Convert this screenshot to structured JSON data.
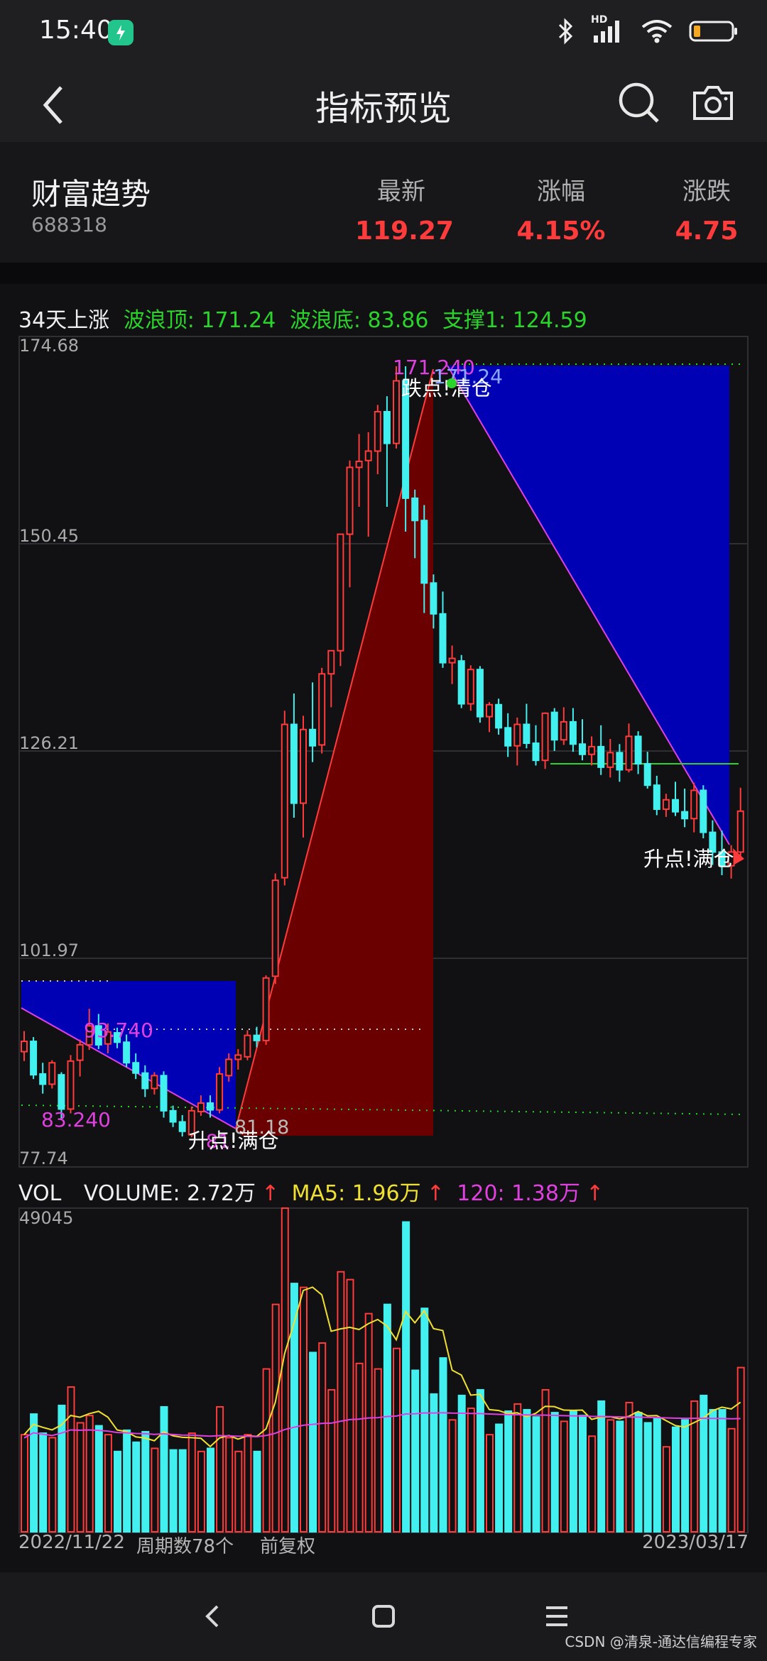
{
  "status_bar": {
    "time": "15:40",
    "network": "HD"
  },
  "nav": {
    "title": "指标预览",
    "icons": [
      "back-icon",
      "search-icon",
      "camera-icon"
    ]
  },
  "quote": {
    "name": "财富趋势",
    "code": "688318",
    "latest_label": "最新",
    "latest": "119.27",
    "change_pct_label": "涨幅",
    "change_pct": "4.15%",
    "change_label": "涨跌",
    "change": "4.75"
  },
  "indicator": {
    "label": "34天上涨",
    "wave_top": "波浪顶: 171.24",
    "wave_bottom": "波浪底: 83.86",
    "support": "支撑1: 124.59"
  },
  "price_axis": [
    "174.68",
    "150.45",
    "126.21",
    "101.97",
    "77.74"
  ],
  "annotations": {
    "top_value": "171.240",
    "top_value2": "171.24",
    "sell_text": "跌点!清仓",
    "low1": "93.740",
    "low2": "83.240",
    "low3_value": "81.18",
    "low3_prefix": "81.",
    "buy_text1": "升点!满仓",
    "buy_text2": "升点!满仓"
  },
  "volume": {
    "label": "VOL",
    "volume": "VOLUME: 2.72万",
    "ma5": "MA5: 1.96万",
    "ma120": "120: 1.38万",
    "axis_max": "49045"
  },
  "footer": {
    "start_date": "2022/11/22",
    "period_count": "周期数78个",
    "adjust": "前复权",
    "end_date": "2023/03/17"
  },
  "watermark": "CSDN @清泉-通达信编程专家",
  "colors": {
    "up": "#ff3b3b",
    "down": "#43f0f0",
    "indicator_green": "#2bd42b",
    "magenta": "#e040e0",
    "ma5": "#f0e030",
    "blue_zone": "#0000b4",
    "red_zone": "#6b0000"
  },
  "chart_data": {
    "type": "candlestick",
    "ylim": [
      77.74,
      174.68
    ],
    "candles": [
      [
        91.2,
        93.6,
        90.1,
        92.4
      ],
      [
        92.4,
        92.9,
        88.0,
        88.5
      ],
      [
        88.6,
        89.9,
        86.3,
        87.4
      ],
      [
        87.4,
        90.2,
        86.9,
        89.9
      ],
      [
        88.5,
        88.8,
        83.3,
        84.5
      ],
      [
        84.5,
        90.8,
        84.0,
        90.1
      ],
      [
        90.2,
        92.6,
        88.3,
        92.0
      ],
      [
        92.0,
        96.2,
        91.4,
        94.2
      ],
      [
        94.2,
        95.6,
        91.5,
        92.0
      ],
      [
        92.1,
        94.5,
        91.0,
        93.5
      ],
      [
        93.4,
        94.0,
        91.6,
        92.3
      ],
      [
        92.3,
        93.2,
        89.4,
        89.9
      ],
      [
        89.9,
        91.0,
        88.0,
        88.7
      ],
      [
        88.7,
        89.6,
        85.9,
        86.9
      ],
      [
        86.9,
        88.8,
        86.2,
        88.4
      ],
      [
        88.4,
        88.9,
        83.5,
        84.3
      ],
      [
        84.3,
        84.9,
        82.4,
        83.0
      ],
      [
        83.0,
        83.8,
        81.3,
        81.9
      ],
      [
        81.5,
        84.8,
        81.2,
        84.3
      ],
      [
        84.2,
        86.1,
        83.7,
        85.2
      ],
      [
        85.2,
        86.1,
        83.5,
        84.4
      ],
      [
        84.4,
        89.4,
        84.0,
        88.6
      ],
      [
        88.4,
        91.0,
        87.7,
        90.3
      ],
      [
        90.3,
        91.5,
        89.1,
        90.8
      ],
      [
        90.6,
        93.7,
        90.2,
        93.1
      ],
      [
        93.1,
        94.1,
        91.7,
        92.5
      ],
      [
        92.5,
        100.1,
        92.0,
        99.8
      ],
      [
        100.0,
        112.0,
        99.1,
        111.2
      ],
      [
        111.5,
        131.0,
        110.6,
        129.4
      ],
      [
        129.4,
        133.0,
        118.5,
        120.2
      ],
      [
        120.2,
        130.4,
        116.2,
        128.8
      ],
      [
        128.8,
        134.3,
        125.0,
        126.9
      ],
      [
        127.0,
        136.0,
        126.0,
        135.3
      ],
      [
        135.3,
        138.0,
        131.4,
        138.0
      ],
      [
        138.0,
        151.6,
        136.2,
        151.6
      ],
      [
        151.6,
        160.2,
        145.4,
        159.4
      ],
      [
        159.4,
        163.3,
        154.8,
        160.1
      ],
      [
        160.2,
        163.5,
        151.3,
        161.3
      ],
      [
        161.3,
        166.7,
        158.6,
        165.9
      ],
      [
        165.9,
        167.7,
        154.8,
        162.2
      ],
      [
        162.2,
        171.2,
        161.6,
        169.5
      ],
      [
        169.5,
        171.2,
        151.9,
        155.8
      ],
      [
        155.8,
        156.8,
        148.8,
        153.2
      ],
      [
        153.2,
        155.0,
        142.4,
        145.9
      ],
      [
        145.9,
        146.9,
        140.6,
        142.3
      ],
      [
        142.3,
        144.9,
        136.0,
        136.6
      ],
      [
        136.6,
        138.6,
        134.1,
        137.1
      ],
      [
        136.8,
        137.5,
        131.3,
        131.8
      ],
      [
        131.8,
        136.3,
        131.0,
        135.8
      ],
      [
        135.8,
        136.2,
        129.6,
        130.3
      ],
      [
        130.3,
        132.0,
        128.5,
        131.7
      ],
      [
        131.7,
        132.4,
        128.2,
        129.0
      ],
      [
        129.0,
        130.7,
        125.6,
        126.9
      ],
      [
        126.9,
        130.2,
        124.6,
        129.4
      ],
      [
        129.4,
        131.8,
        126.6,
        127.2
      ],
      [
        127.2,
        129.3,
        124.6,
        125.2
      ],
      [
        125.2,
        130.8,
        124.2,
        130.7
      ],
      [
        130.8,
        131.3,
        126.3,
        127.6
      ],
      [
        127.6,
        131.4,
        127.0,
        129.7
      ],
      [
        129.7,
        131.3,
        126.2,
        127.1
      ],
      [
        127.1,
        130.0,
        125.2,
        125.9
      ],
      [
        125.9,
        128.0,
        124.6,
        126.8
      ],
      [
        126.8,
        129.3,
        123.5,
        124.4
      ],
      [
        124.4,
        127.7,
        123.2,
        126.1
      ],
      [
        126.1,
        127.1,
        122.7,
        124.1
      ],
      [
        124.1,
        129.5,
        123.8,
        128.0
      ],
      [
        128.0,
        128.6,
        123.6,
        124.8
      ],
      [
        124.8,
        126.2,
        121.9,
        122.3
      ],
      [
        122.3,
        123.4,
        118.8,
        119.5
      ],
      [
        119.5,
        121.3,
        118.6,
        120.6
      ],
      [
        120.6,
        122.7,
        118.7,
        119.2
      ],
      [
        119.2,
        121.9,
        117.4,
        118.4
      ],
      [
        118.4,
        122.6,
        116.8,
        121.7
      ],
      [
        121.7,
        122.3,
        116.1,
        116.8
      ],
      [
        116.8,
        118.2,
        113.0,
        114.5
      ],
      [
        114.5,
        117.0,
        111.8,
        112.9
      ],
      [
        112.9,
        115.3,
        111.4,
        114.5
      ],
      [
        114.5,
        122.0,
        113.8,
        119.27
      ]
    ],
    "volume_ylim": [
      0,
      49045
    ]
  }
}
